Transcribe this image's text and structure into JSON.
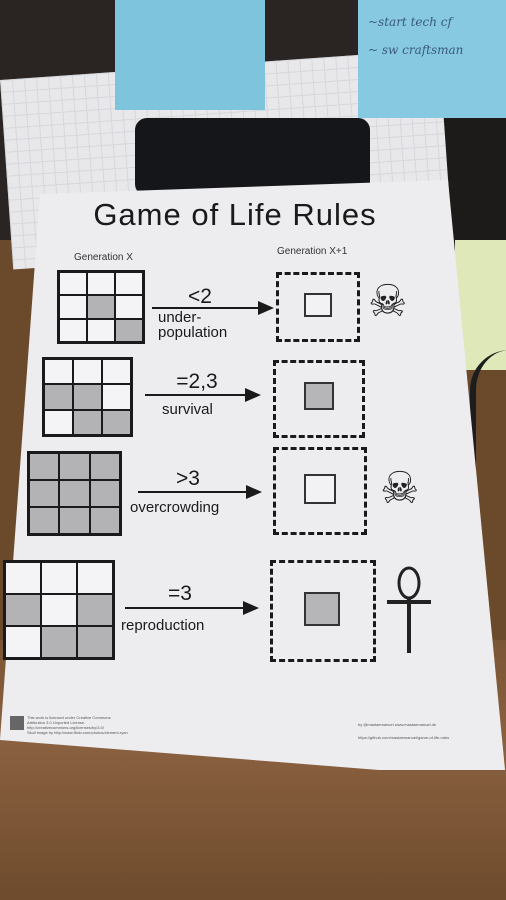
{
  "sticky_note_text": [
    "~start tech cf",
    "~ sw craftsman"
  ],
  "paper": {
    "title": "Game of Life Rules",
    "generation_x_label": "Generation X",
    "generation_x1_label": "Generation X+1",
    "rules": [
      {
        "symbol": "<2",
        "name": "under-",
        "name2": "population",
        "result": "dead",
        "icon": "skull-crossbones-icon",
        "grid": [
          0,
          0,
          0,
          0,
          1,
          0,
          0,
          0,
          1
        ],
        "center_on": false
      },
      {
        "symbol": "=2,3",
        "name": "survival",
        "name2": "",
        "result": "alive",
        "icon": "",
        "grid": [
          0,
          0,
          0,
          1,
          1,
          0,
          0,
          1,
          1
        ],
        "center_on": true
      },
      {
        "symbol": ">3",
        "name": "overcrowding",
        "name2": "",
        "result": "dead",
        "icon": "skull-crossbones-icon",
        "grid": [
          1,
          1,
          1,
          1,
          1,
          1,
          1,
          1,
          1
        ],
        "center_on": false
      },
      {
        "symbol": "=3",
        "name": "reproduction",
        "name2": "",
        "result": "born",
        "icon": "ankh-icon",
        "grid": [
          0,
          0,
          0,
          1,
          0,
          1,
          0,
          1,
          1
        ],
        "center_on": true
      }
    ],
    "footer_left": [
      "This work is licensed under Creative Commons",
      "Attribution 3.0 Unported License.",
      "http://creativecommons.org/licenses/by/3.0/",
      "Skull image by http://www.flickr.com/photos/clement-ryan"
    ],
    "footer_right": [
      "by @mastaemanuel www.mastaemanuel.de",
      "https://github.com/mastaemanuel/game-of-life-rules"
    ]
  }
}
